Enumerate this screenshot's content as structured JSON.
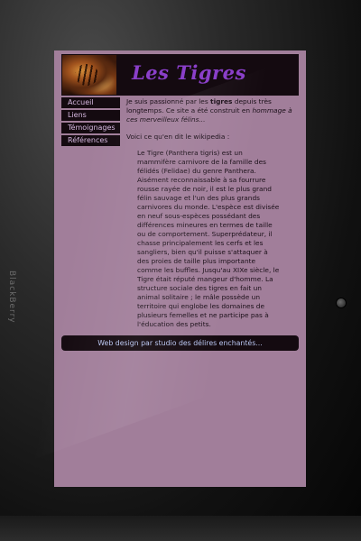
{
  "device": {
    "brand": "BlackBerry"
  },
  "header": {
    "site_title": "Les Tigres",
    "logo_icon": "tiger-photo-icon"
  },
  "nav": {
    "items": [
      {
        "label": "Accueil"
      },
      {
        "label": "Liens"
      },
      {
        "label": "Témoignages"
      },
      {
        "label": "Références"
      }
    ]
  },
  "main": {
    "intro_part1": "Je suis passionné par les ",
    "intro_bold": "tigres",
    "intro_part2": " depuis très longtemps. Ce site a été construit en ",
    "intro_italic": "hommage à ces merveilleux félins...",
    "quote_lead": "Voici ce qu'en dit le wikipedia :",
    "quote": "Le Tigre (Panthera tigris) est un mammifère carnivore de la famille des félidés (Felidae) du genre Panthera. Aisément reconnaissable à sa fourrure rousse rayée de noir, il est le plus grand félin sauvage et l'un des plus grands carnivores du monde. L'espèce est divisée en neuf sous-espèces possédant des différences mineures en termes de taille ou de comportement. Superprédateur, il chasse principalement les cerfs et les sangliers, bien qu'il puisse s'attaquer à des proies de taille plus importante comme les buffles. Jusqu'au XIXe siècle, le Tigre était réputé mangeur d'homme. La structure sociale des tigres en fait un animal solitaire ; le mâle possède un territoire qui englobe les domaines de plusieurs femelles et ne participe pas à l'éducation des petits."
  },
  "footer": {
    "credit": "Web design par studio des délires enchantés..."
  },
  "colors": {
    "page_bg": "#a17e9a",
    "panel_bg": "#140a10",
    "title_color": "#8a3fc9",
    "nav_text": "#d6b8e0",
    "footer_text": "#b9c6f2"
  }
}
